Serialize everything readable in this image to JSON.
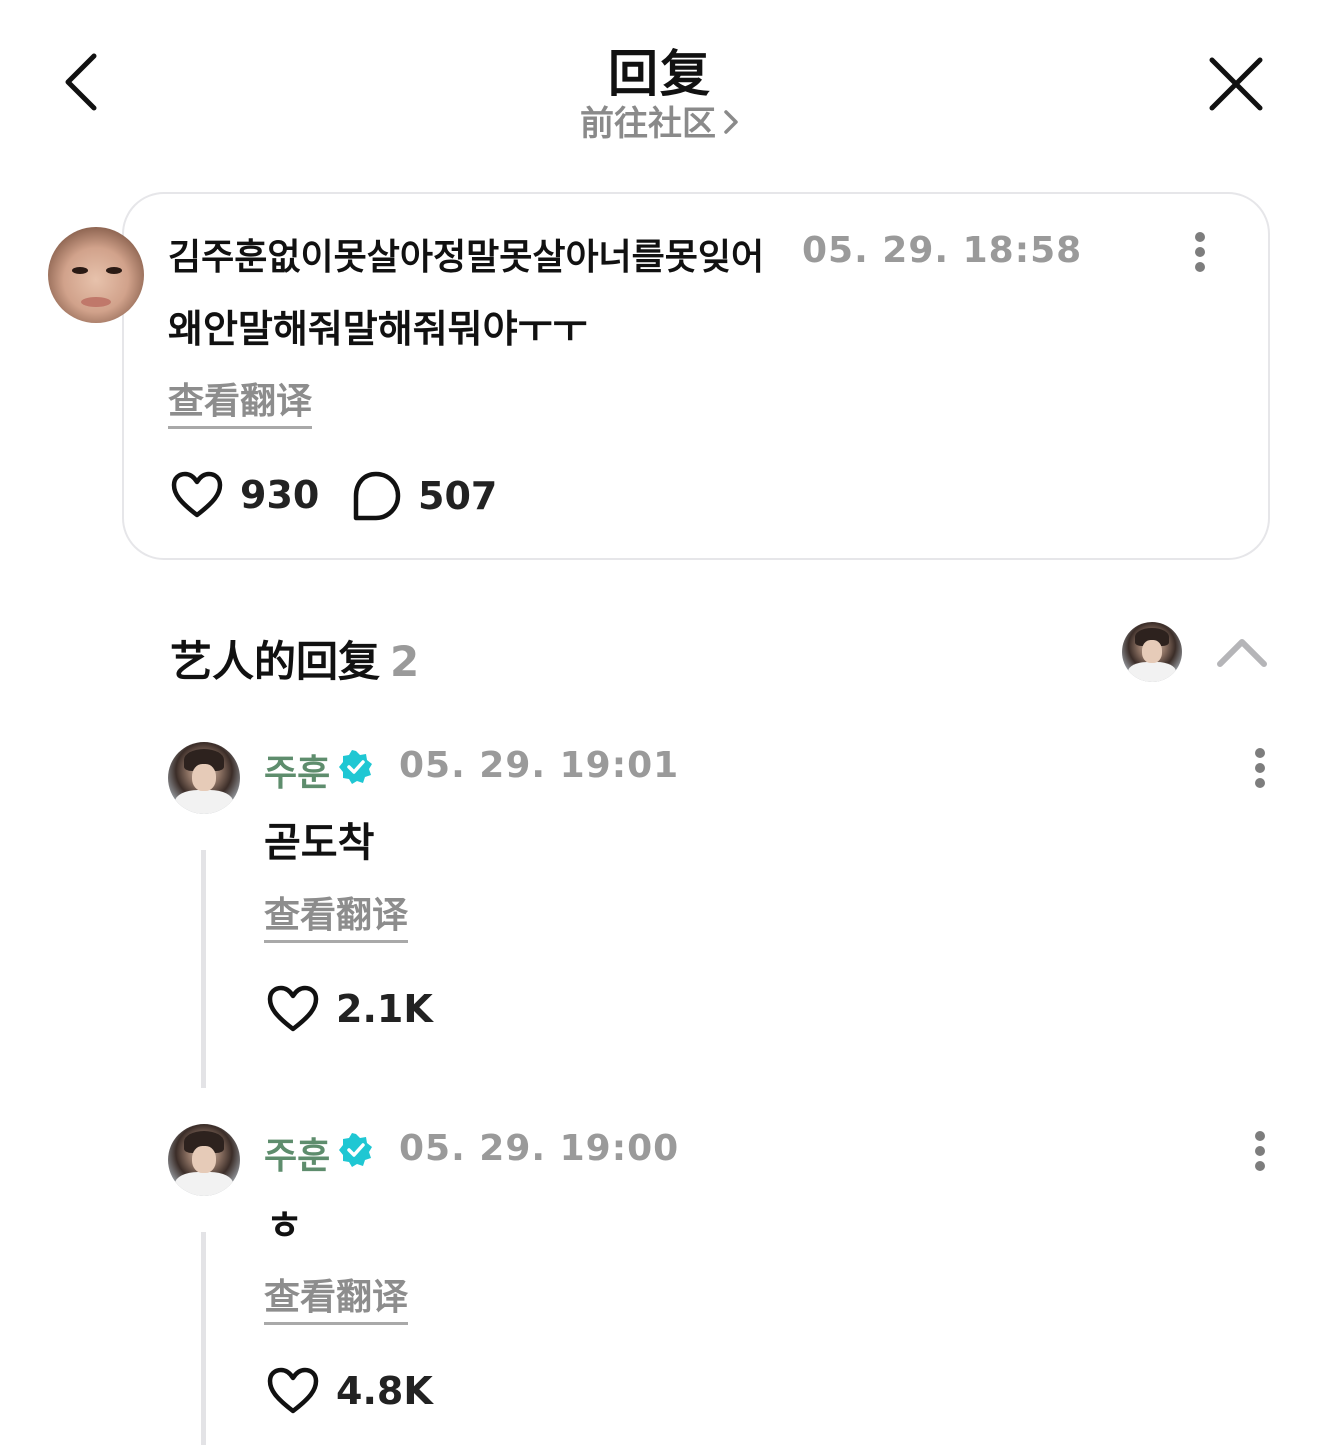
{
  "header": {
    "title": "回复",
    "community_link": "前往社区"
  },
  "post": {
    "username": "김주훈없이못살아정말못살아너를못잊어",
    "timestamp": "05. 29. 18:58",
    "body": "왜안말해줘말해줘뭐야ㅜㅜ",
    "translate_label": "查看翻译",
    "likes": "930",
    "comments": "507"
  },
  "artist_replies": {
    "title": "艺人的回复",
    "count": "2",
    "replies": [
      {
        "username": "주훈",
        "timestamp": "05. 29. 19:01",
        "body": "곧도착",
        "translate_label": "查看翻译",
        "likes": "2.1K"
      },
      {
        "username": "주훈",
        "timestamp": "05. 29. 19:00",
        "body": "ㅎ",
        "translate_label": "查看翻译",
        "likes": "4.8K"
      }
    ]
  },
  "icons": {
    "back": "chevron-left-icon",
    "close": "close-icon",
    "more": "more-vertical-icon",
    "like": "heart-icon",
    "comment": "comment-bubble-icon",
    "verified": "verified-badge-icon",
    "collapse": "chevron-up-icon"
  },
  "colors": {
    "verified_badge": "#1fc7d3",
    "artist_name": "#5e8d6d",
    "muted_text": "#9a9a9a"
  }
}
